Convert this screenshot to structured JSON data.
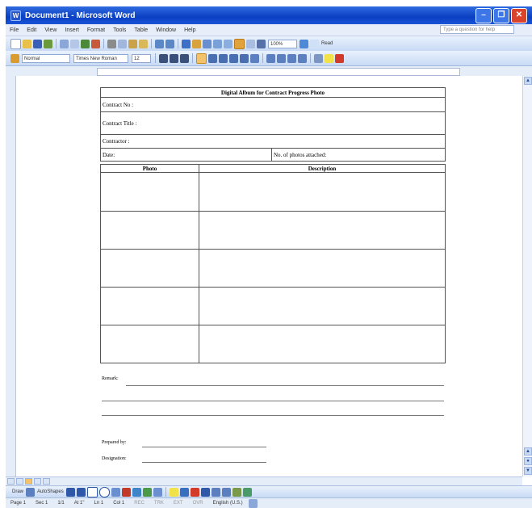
{
  "window": {
    "title": "Document1 - Microsoft Word",
    "app_icon": "W"
  },
  "menubar": {
    "items": [
      "File",
      "Edit",
      "View",
      "Insert",
      "Format",
      "Tools",
      "Table",
      "Window",
      "Help"
    ],
    "ask_placeholder": "Type a question for help"
  },
  "toolbar": {
    "zoom": "100%",
    "read": "Read"
  },
  "formatting": {
    "style": "Normal",
    "font": "Times New Roman",
    "size": "12"
  },
  "document": {
    "heading": "Digital Album for Contract Progress Photo",
    "contract_no_label": "Contract No :",
    "contract_title_label": "Contract Title :",
    "contractor_label": "Contractor :",
    "date_label": "Date:",
    "photos_attached_label": "No. of photos attached:",
    "photo_col": "Photo",
    "description_col": "Description",
    "remark_label": "Remark:",
    "prepared_by_label": "Prepared by:",
    "designation_label": "Designation:"
  },
  "statusbar": {
    "page": "Page 1",
    "section": "Sec 1",
    "pages": "1/1",
    "at": "At 1\"",
    "line": "Ln 1",
    "col": "Col 1",
    "rec": "REC",
    "trk": "TRK",
    "ext": "EXT",
    "ovr": "OVR",
    "language": "English (U.S.)"
  },
  "drawbar": {
    "draw": "Draw",
    "autoshapes": "AutoShapes"
  },
  "colors": {
    "title_blue": "#0a3fc2",
    "close_red": "#d9442a",
    "highlight_orange": "#f3c36b"
  }
}
